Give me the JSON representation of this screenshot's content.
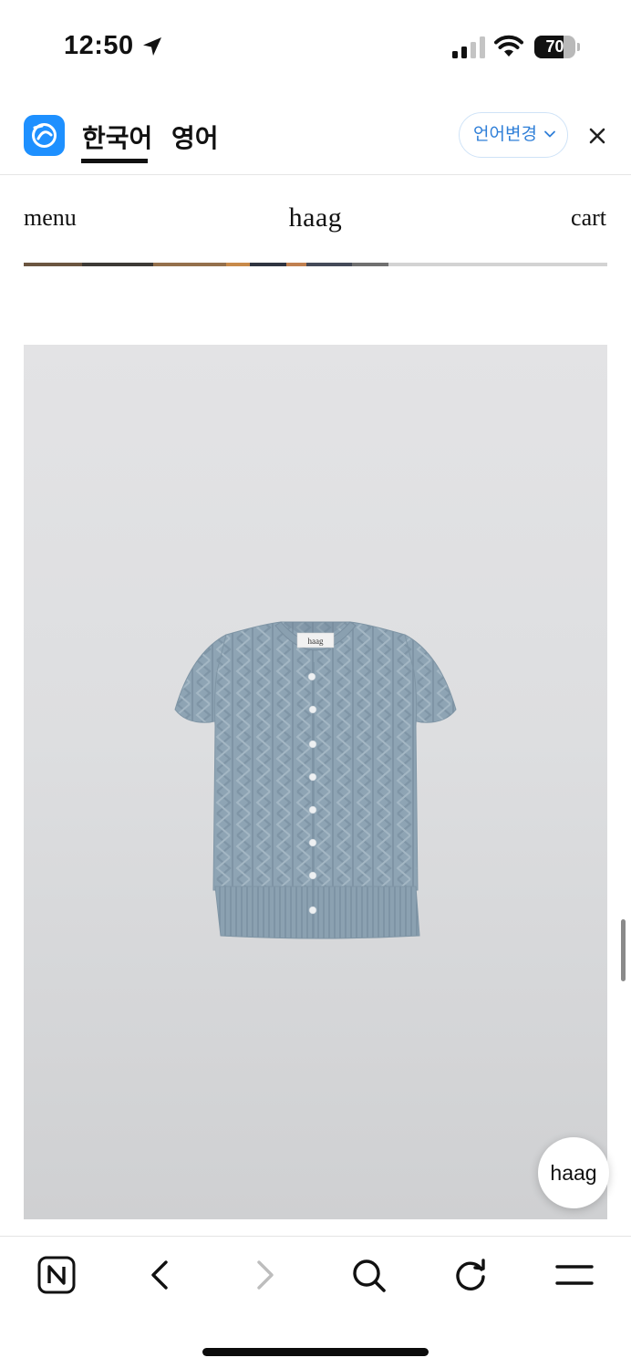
{
  "status_bar": {
    "time": "12:50",
    "battery_level": "70",
    "battery_fraction": 0.7,
    "signal_bars": "2 of 4",
    "icons": [
      "location-arrow-icon",
      "cellular-signal-icon",
      "wifi-icon",
      "battery-icon"
    ]
  },
  "translate_bar": {
    "tabs": [
      {
        "label": "한국어",
        "selected": true
      },
      {
        "label": "영어",
        "selected": false
      }
    ],
    "change_language_label": "언어변경",
    "accent_color": "#1e90ff",
    "icons": [
      "translate-app-icon",
      "chevron-down-icon",
      "close-icon"
    ]
  },
  "site_header": {
    "menu_label": "menu",
    "brand": "haag",
    "cart_label": "cart"
  },
  "product": {
    "image_description_icon": "product-photo",
    "label_text": "haag",
    "garment_color": "#8ea4b4"
  },
  "floating_button": {
    "label": "haag"
  },
  "browser_toolbar": {
    "icons": [
      "naver-home-icon",
      "back-icon",
      "forward-icon",
      "search-icon",
      "reload-icon",
      "menu-icon"
    ]
  }
}
